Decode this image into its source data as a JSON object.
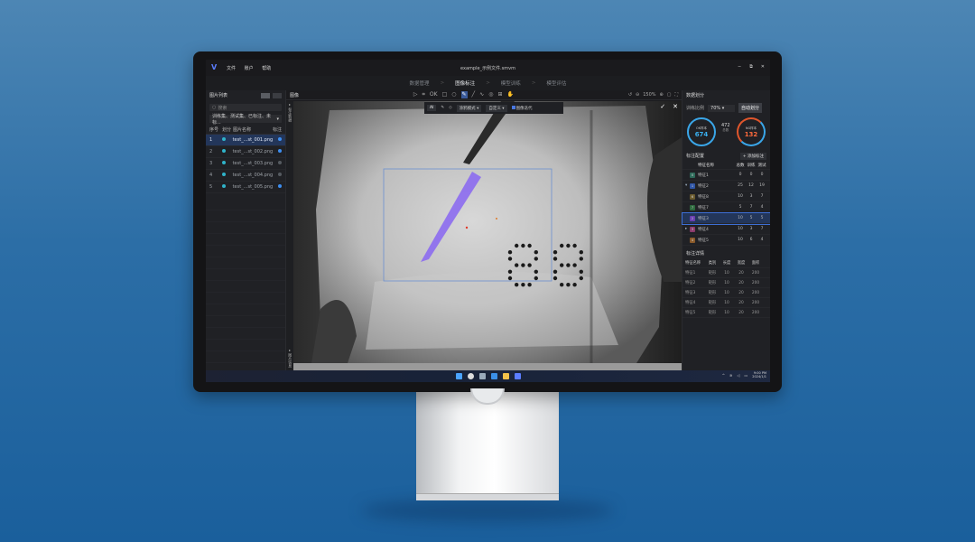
{
  "window": {
    "title": "example_示例文件.smvm",
    "menu": [
      "文件",
      "账户",
      "帮助"
    ],
    "controls": [
      "−",
      "⧉",
      "✕"
    ]
  },
  "steps": [
    {
      "label": "数据管理",
      "active": false
    },
    {
      "label": "图像标注",
      "active": true
    },
    {
      "label": "模型训练",
      "active": false
    },
    {
      "label": "模型评估",
      "active": false
    }
  ],
  "left_panel": {
    "title": "图片列表",
    "search_placeholder": "搜索",
    "filter": "训练集、测试集、已标注、未标...",
    "columns": [
      "序号",
      "划分",
      "图片名称",
      "标注"
    ],
    "rows": [
      {
        "idx": "1",
        "name": "test_...st_001.png",
        "tag_color": "#3d8ef0",
        "selected": true
      },
      {
        "idx": "2",
        "name": "test_...st_002.png",
        "tag_color": "#3d8ef0",
        "selected": false
      },
      {
        "idx": "3",
        "name": "test_...st_003.png",
        "tag_color": "#555a60",
        "selected": false
      },
      {
        "idx": "4",
        "name": "test_...st_004.png",
        "tag_color": "#555a60",
        "selected": false
      },
      {
        "idx": "5",
        "name": "test_...st_005.png",
        "tag_color": "#3d8ef0",
        "selected": false
      }
    ]
  },
  "center": {
    "title": "图像",
    "zoom": "150%",
    "left_strip_top": "标注数据",
    "left_strip_bottom": "图片信息",
    "float_toolbar": {
      "ai": "AI",
      "mode_label": "涂鸦模式",
      "custom_label": "自定义",
      "checkbox_label": "图像迭代"
    },
    "digits": "88"
  },
  "right_panel": {
    "title": "数据划分",
    "ratio_label": "训练比例",
    "ratio_value": "70%",
    "auto_button": "自动划分",
    "ok_label": "OK样本",
    "ok_value": "674",
    "ng_label": "NG样本",
    "ng_value": "132",
    "total_value": "472",
    "total_label": "总数",
    "feature_section": "标注配置",
    "add_button": "+ 添加标注",
    "feature_columns": [
      "特征名称",
      "总数",
      "训练",
      "测试"
    ],
    "features": [
      {
        "id": "0",
        "name": "特征1",
        "total": "0",
        "train": "0",
        "test": "0",
        "color": "#2e6a5a",
        "expand": "",
        "selected": false
      },
      {
        "id": "1",
        "name": "特征2",
        "total": "25",
        "train": "12",
        "test": "19",
        "color": "#2f55a6",
        "expand": "▾",
        "selected": false
      },
      {
        "id": "6",
        "name": "特征8",
        "total": "10",
        "train": "3",
        "test": "7",
        "color": "#6b5b2e",
        "expand": "",
        "selected": false
      },
      {
        "id": "7",
        "name": "特征7",
        "total": "5",
        "train": "7",
        "test": "4",
        "color": "#2e6a3e",
        "expand": "",
        "selected": false
      },
      {
        "id": "2",
        "name": "特征3",
        "total": "10",
        "train": "5",
        "test": "5",
        "color": "#6a3fb0",
        "expand": "",
        "selected": true
      },
      {
        "id": "3",
        "name": "特征4",
        "total": "10",
        "train": "3",
        "test": "7",
        "color": "#8a3a6a",
        "expand": "▸",
        "selected": false
      },
      {
        "id": "4",
        "name": "特征5",
        "total": "10",
        "train": "6",
        "test": "4",
        "color": "#8a5a2a",
        "expand": "",
        "selected": false
      }
    ],
    "detail_section": "标注详情",
    "detail_columns": [
      "特征名称",
      "类别",
      "长度",
      "宽度",
      "面积"
    ],
    "details": [
      [
        "特征1",
        "矩形",
        "10",
        "20",
        "200"
      ],
      [
        "特征2",
        "矩形",
        "10",
        "20",
        "200"
      ],
      [
        "特征3",
        "矩形",
        "10",
        "20",
        "200"
      ],
      [
        "特征4",
        "矩形",
        "10",
        "20",
        "200"
      ],
      [
        "特征5",
        "矩形",
        "10",
        "20",
        "200"
      ]
    ]
  },
  "taskbar": {
    "time": "9:00 PM",
    "date": "2024/1/1"
  }
}
